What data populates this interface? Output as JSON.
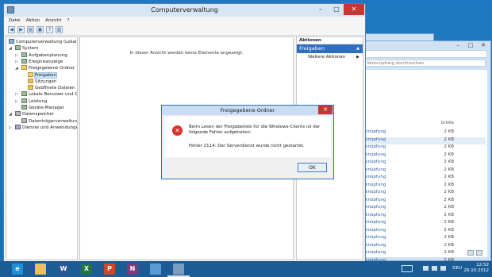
{
  "mmc": {
    "title": "Computerverwaltung",
    "menu": [
      "Datei",
      "Aktion",
      "Ansicht",
      "?"
    ],
    "tree": [
      {
        "label": "Computerverwaltung (Lokal)",
        "level": 0,
        "icon": "comp",
        "exp": ""
      },
      {
        "label": "System",
        "level": 1,
        "icon": "tool",
        "exp": "◢"
      },
      {
        "label": "Aufgabenplanung",
        "level": 2,
        "icon": "tool",
        "exp": "▷"
      },
      {
        "label": "Ereignisanzeige",
        "level": 2,
        "icon": "tool",
        "exp": "▷"
      },
      {
        "label": "Freigegebene Ordner",
        "level": 2,
        "icon": "share",
        "exp": "◢"
      },
      {
        "label": "Freigaben",
        "level": 3,
        "icon": "share",
        "exp": "",
        "selected": true
      },
      {
        "label": "Sitzungen",
        "level": 3,
        "icon": "folder",
        "exp": ""
      },
      {
        "label": "Geöffnete Dateien",
        "level": 3,
        "icon": "folder",
        "exp": ""
      },
      {
        "label": "Lokale Benutzer und Gr",
        "level": 2,
        "icon": "tool",
        "exp": "▷"
      },
      {
        "label": "Leistung",
        "level": 2,
        "icon": "tool",
        "exp": "▷"
      },
      {
        "label": "Geräte-Manager",
        "level": 2,
        "icon": "tool",
        "exp": ""
      },
      {
        "label": "Datenspeicher",
        "level": 1,
        "icon": "disk",
        "exp": "◢"
      },
      {
        "label": "Datenträgerverwaltung",
        "level": 2,
        "icon": "disk",
        "exp": ""
      },
      {
        "label": "Dienste und Anwendungen",
        "level": 1,
        "icon": "svc",
        "exp": "▷"
      }
    ],
    "empty_message": "In dieser Ansicht werden keine Elemente angezeigt.",
    "actions": {
      "header": "Aktionen",
      "group": "Freigaben",
      "item": "Weitere Aktionen"
    }
  },
  "dialog": {
    "title": "Freigegebene Ordner",
    "message": "Beim Lesen der Freigabeliste für die Windows-Clients ist der folgende Fehler aufgetreten:",
    "detail": "Fehler 2114: Der Serverdienst wurde nicht gestartet.",
    "ok": "OK"
  },
  "explorer_bg": {
    "search_placeholder": "Verknüpfung durchsuchen",
    "column_type_partial": "p",
    "column_size": "Größe",
    "rows": [
      {
        "name": "rknüpfung",
        "size": "2 KB",
        "selected": false
      },
      {
        "name": "rknüpfung",
        "size": "2 KB",
        "selected": true
      },
      {
        "name": "rknüpfung",
        "size": "2 KB",
        "selected": false
      },
      {
        "name": "rknüpfung",
        "size": "2 KB",
        "selected": false
      },
      {
        "name": "rknüpfung",
        "size": "2 KB",
        "selected": false
      },
      {
        "name": "rknüpfung",
        "size": "2 KB",
        "selected": false
      },
      {
        "name": "rknüpfung",
        "size": "2 KB",
        "selected": false
      },
      {
        "name": "rknüpfung",
        "size": "2 KB",
        "selected": false
      },
      {
        "name": "rknüpfung",
        "size": "2 KB",
        "selected": false
      },
      {
        "name": "rknüpfung",
        "size": "2 KB",
        "selected": false
      },
      {
        "name": "rknüpfung",
        "size": "2 KB",
        "selected": false
      },
      {
        "name": "rknüpfung",
        "size": "2 KB",
        "selected": false
      },
      {
        "name": "rknüpfung",
        "size": "2 KB",
        "selected": false
      },
      {
        "name": "rknüpfung",
        "size": "2 KB",
        "selected": false
      },
      {
        "name": "rknüpfung",
        "size": "2 KB",
        "selected": false
      },
      {
        "name": "rknüpfung",
        "size": "2 KB",
        "selected": false
      },
      {
        "name": "rknüpfung",
        "size": "2 KB",
        "selected": false
      },
      {
        "name": "rknüpfung",
        "size": "2 KB",
        "selected": false
      }
    ]
  },
  "taskbar": {
    "apps": [
      {
        "name": "internet-explorer",
        "glyph": "e",
        "color": "#1e90d8"
      },
      {
        "name": "file-explorer",
        "glyph": "",
        "color": "#e8c35a"
      },
      {
        "name": "word",
        "glyph": "W",
        "color": "#2b579a"
      },
      {
        "name": "excel",
        "glyph": "X",
        "color": "#217346"
      },
      {
        "name": "powerpoint",
        "glyph": "P",
        "color": "#d24726"
      },
      {
        "name": "onenote",
        "glyph": "N",
        "color": "#80397b"
      },
      {
        "name": "control-panel",
        "glyph": "",
        "color": "#5a9bd5"
      },
      {
        "name": "computer-management",
        "glyph": "",
        "color": "#7d9cbc"
      }
    ],
    "language": "DEU",
    "time": "12:52",
    "date": "26.10.2012"
  }
}
